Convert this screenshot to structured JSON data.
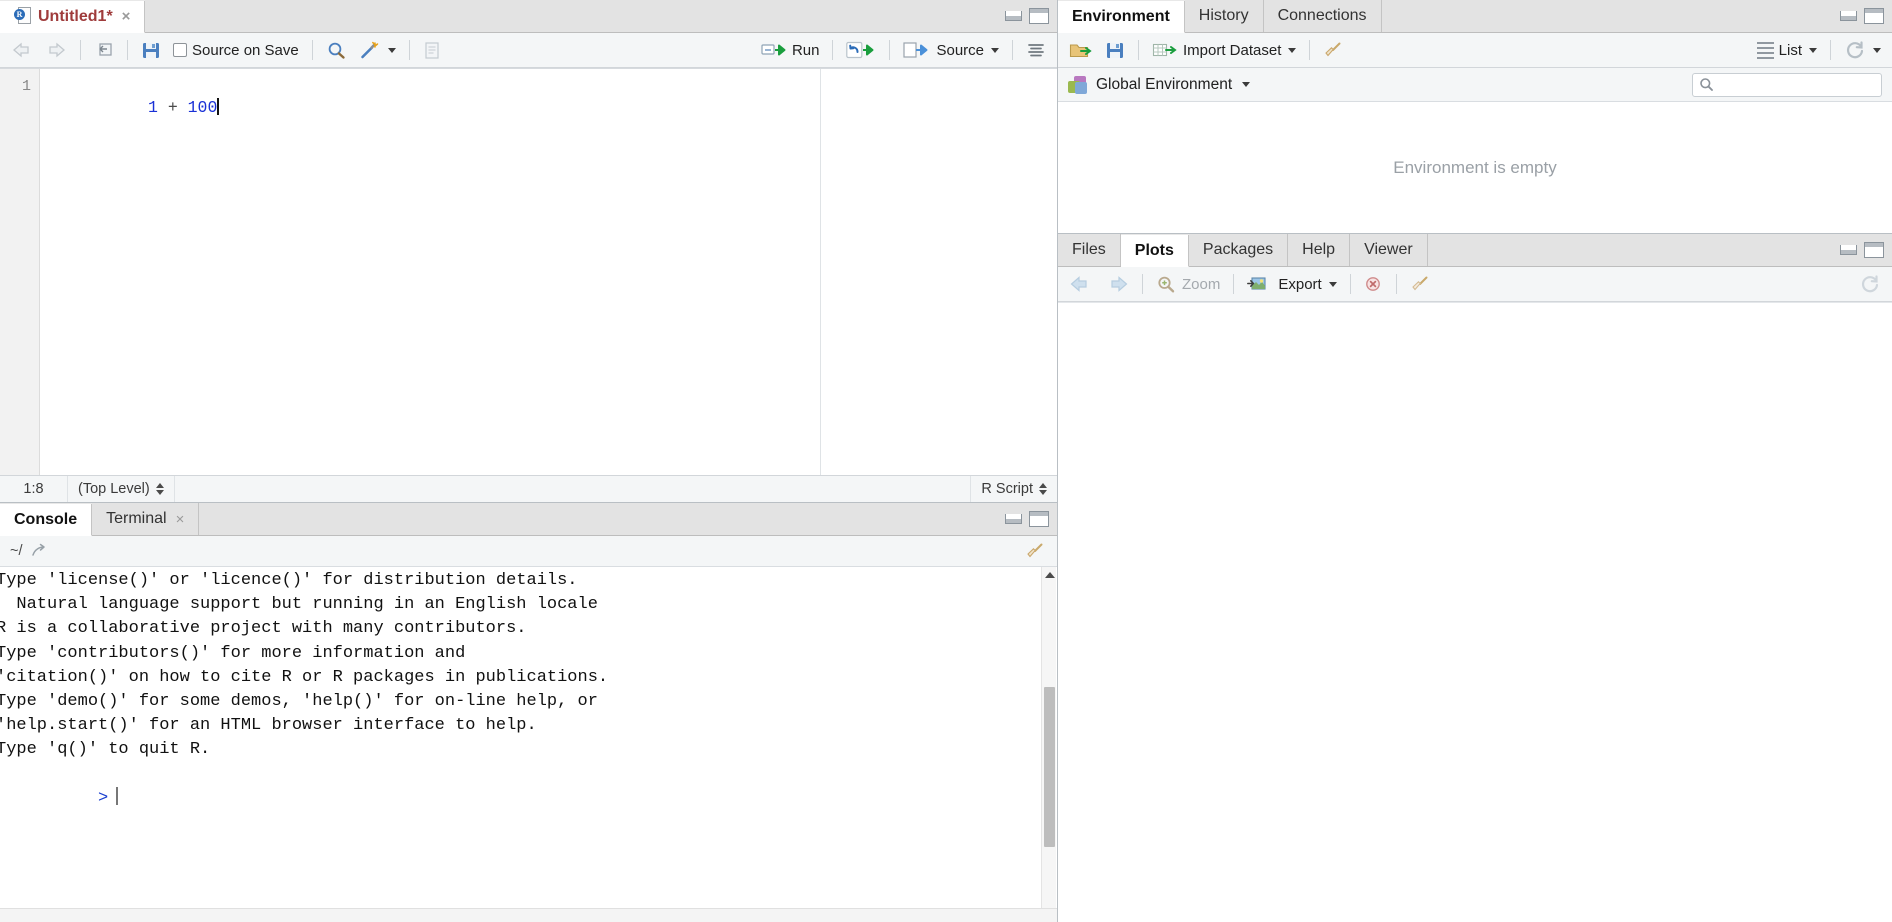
{
  "source": {
    "tab_label": "Untitled1*",
    "tab_close": "×",
    "r_badge": "R",
    "toolbar": {
      "back_icon": "back-arrow-icon",
      "forward_icon": "forward-arrow-icon",
      "popout_icon": "show-in-new-window-icon",
      "save_icon": "save-icon",
      "source_on_save_label": "Source on Save",
      "find_icon": "find-replace-icon",
      "magic_icon": "code-tools-icon",
      "compile_icon": "compile-report-icon",
      "run_label": "Run",
      "rerun_icon": "rerun-icon",
      "source_label": "Source",
      "outline_icon": "document-outline-icon"
    },
    "code": {
      "line_number": "1",
      "tokens": [
        "1",
        " + ",
        "100"
      ]
    },
    "status": {
      "cursor_position": "1:8",
      "scope": "(Top Level)",
      "file_type": "R Script"
    }
  },
  "console": {
    "tabs": [
      {
        "label": "Console",
        "active": true,
        "closable": false
      },
      {
        "label": "Terminal",
        "active": false,
        "closable": true
      }
    ],
    "tab_close": "×",
    "path": "~/",
    "path_icon": "open-in-window-icon",
    "clear_icon": "broom-icon",
    "lines": [
      "Type 'license()' or 'licence()' for distribution details.",
      "",
      "  Natural language support but running in an English locale",
      "",
      "R is a collaborative project with many contributors.",
      "Type 'contributors()' for more information and",
      "'citation()' on how to cite R or R packages in publications.",
      "",
      "Type 'demo()' for some demos, 'help()' for on-line help, or",
      "'help.start()' for an HTML browser interface to help.",
      "Type 'q()' to quit R.",
      ""
    ],
    "prompt": ">"
  },
  "environment": {
    "tabs": [
      {
        "label": "Environment",
        "active": true
      },
      {
        "label": "History",
        "active": false
      },
      {
        "label": "Connections",
        "active": false
      }
    ],
    "toolbar": {
      "load_icon": "load-workspace-icon",
      "save_icon": "save-workspace-icon",
      "import_label": "Import Dataset",
      "clear_icon": "broom-icon",
      "view_mode_label": "List",
      "view_mode_icon": "list-view-icon",
      "refresh_icon": "refresh-icon"
    },
    "selected_environment": "Global Environment",
    "search_placeholder": "",
    "search_value": "",
    "empty_message": "Environment is empty"
  },
  "files": {
    "tabs": [
      {
        "label": "Files",
        "active": false
      },
      {
        "label": "Plots",
        "active": true
      },
      {
        "label": "Packages",
        "active": false
      },
      {
        "label": "Help",
        "active": false
      },
      {
        "label": "Viewer",
        "active": false
      }
    ],
    "toolbar": {
      "back_icon": "back-arrow-icon",
      "forward_icon": "forward-arrow-icon",
      "zoom_label": "Zoom",
      "export_label": "Export",
      "remove_icon": "remove-plot-icon",
      "clear_all_icon": "broom-icon",
      "refresh_icon": "refresh-icon"
    }
  },
  "window_controls": {
    "minimize_icon": "minimize-icon",
    "maximize_icon": "maximize-icon"
  },
  "colors": {
    "tab_active_bg": "#ffffff",
    "tab_inactive_bg": "#e3e3e3",
    "toolbar_bg": "#f4f6f7",
    "source_title": "#9f3b3b",
    "number_token": "#1a31d6",
    "prompt": "#1a3fd0",
    "accent_green": "#1a9e3e",
    "empty_text": "#9aa0a6"
  }
}
